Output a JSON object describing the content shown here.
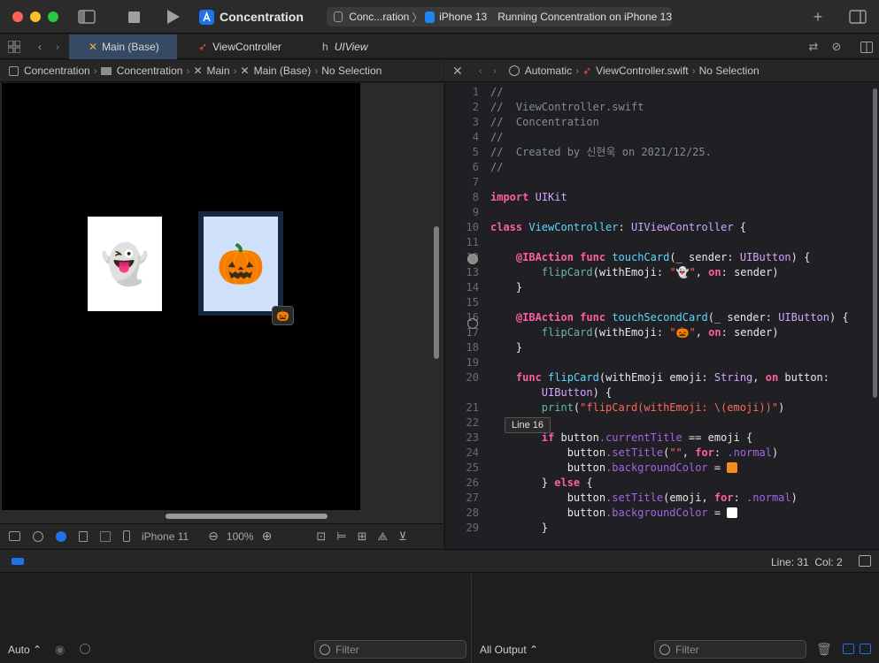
{
  "window": {
    "app_title": "Concentration",
    "scheme_name": "Conc...ration",
    "destination": "iPhone 13",
    "activity_status": "Running Concentration on iPhone 13"
  },
  "tabs": [
    {
      "label": "Main (Base)",
      "active": true
    },
    {
      "label": "ViewController",
      "active": false
    },
    {
      "label": "UIView",
      "active": false
    }
  ],
  "left_jumpbar": [
    "Concentration",
    "Concentration",
    "Main",
    "Main (Base)",
    "No Selection"
  ],
  "right_jumpbar": {
    "mode": "Automatic",
    "file": "ViewController.swift",
    "selection": "No Selection"
  },
  "canvas": {
    "card1_emoji": "👻",
    "card2_emoji": "🎃",
    "badge_emoji": "🎃",
    "card1_color": "#ffffff",
    "card2_color": "#cfe0fb",
    "selection_color": "#152740"
  },
  "canvas_toolbar": {
    "device": "iPhone 11",
    "zoom": "100%"
  },
  "editor": {
    "tooltip": "Line 16",
    "lines": [
      {
        "n": "1",
        "text": "//"
      },
      {
        "n": "2",
        "text": "//  ViewController.swift"
      },
      {
        "n": "3",
        "text": "//  Concentration"
      },
      {
        "n": "4",
        "text": "//"
      },
      {
        "n": "5",
        "text": "//  Created by 신현욱 on 2021/12/25."
      },
      {
        "n": "6",
        "text": "//"
      },
      {
        "n": "7",
        "text": ""
      },
      {
        "n": "8",
        "text": "import UIKit"
      },
      {
        "n": "9",
        "text": ""
      },
      {
        "n": "10",
        "text": "class ViewController: UIViewController {"
      },
      {
        "n": "11",
        "text": ""
      },
      {
        "n": "12",
        "text": "    @IBAction func touchCard(_ sender: UIButton) {"
      },
      {
        "n": "13",
        "text": "        flipCard(withEmoji: \"👻\", on: sender)"
      },
      {
        "n": "14",
        "text": "    }"
      },
      {
        "n": "15",
        "text": ""
      },
      {
        "n": "16",
        "text": "    @IBAction func touchSecondCard(_ sender: UIButton) {"
      },
      {
        "n": "17",
        "text": "        flipCard(withEmoji: \"🎃\", on: sender)"
      },
      {
        "n": "18",
        "text": "    }"
      },
      {
        "n": "19",
        "text": ""
      },
      {
        "n": "20",
        "text": "    func flipCard(withEmoji emoji: String, on button:"
      },
      {
        "n": "",
        "text": "        UIButton) {"
      },
      {
        "n": "21",
        "text": "        print(\"flipCard(withEmoji: \\(emoji))\")"
      },
      {
        "n": "22",
        "text": ""
      },
      {
        "n": "23",
        "text": "        if button.currentTitle == emoji {"
      },
      {
        "n": "24",
        "text": "            button.setTitle(\"\", for: .normal)"
      },
      {
        "n": "25",
        "text": "            button.backgroundColor = "
      },
      {
        "n": "26",
        "text": "        } else {"
      },
      {
        "n": "27",
        "text": "            button.setTitle(emoji, for: .normal)"
      },
      {
        "n": "28",
        "text": "            button.backgroundColor = "
      },
      {
        "n": "29",
        "text": "        }"
      }
    ],
    "swatch_orange": "#f28c1e",
    "swatch_white": "#ffffff"
  },
  "debug_bar": {
    "position": "Line: 31  Col: 2"
  },
  "debug_area": {
    "variables_scope": "Auto",
    "filter_placeholder_left": "Filter",
    "output_scope": "All Output",
    "filter_placeholder_right": "Filter"
  }
}
